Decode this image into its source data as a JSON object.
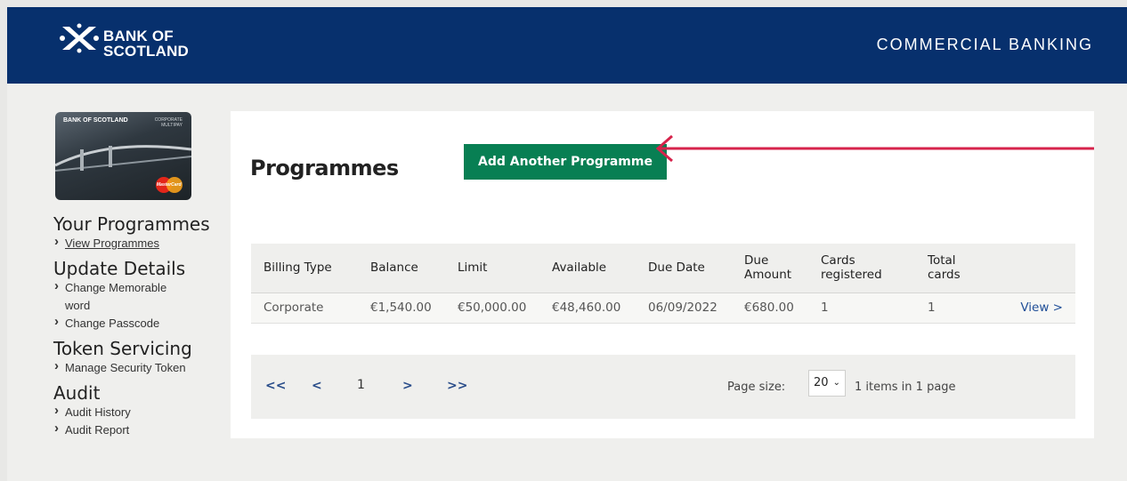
{
  "header": {
    "logo_line1": "BANK OF",
    "logo_line2": "SCOTLAND",
    "section": "COMMERCIAL BANKING"
  },
  "card": {
    "brand": "BANK OF SCOTLAND",
    "corp_line1": "CORPORATE",
    "corp_line2": "MULTIPAY",
    "network": "MasterCard"
  },
  "sidebar": {
    "sections": [
      {
        "title": "Your Programmes",
        "links": [
          "View Programmes"
        ]
      },
      {
        "title": "Update Details",
        "links": [
          "Change Memorable word",
          "Change Passcode"
        ]
      },
      {
        "title": "Token Servicing",
        "links": [
          "Manage Security Token"
        ]
      },
      {
        "title": "Audit",
        "links": [
          "Audit History",
          "Audit Report"
        ]
      }
    ]
  },
  "main": {
    "title": "Programmes",
    "add_button": "Add Another Programme",
    "table": {
      "headers": [
        "Billing Type",
        "Balance",
        "Limit",
        "Available",
        "Due Date",
        "Due Amount",
        "Cards registered",
        "Total cards",
        ""
      ],
      "rows": [
        [
          "Corporate",
          "€1,540.00",
          "€50,000.00",
          "€48,460.00",
          "06/09/2022",
          "€680.00",
          "1",
          "1",
          "View >"
        ]
      ]
    },
    "pager": {
      "first": "<<",
      "prev": "<",
      "page": "1",
      "next": ">",
      "last": ">>",
      "page_size_label": "Page size:",
      "page_size": "20",
      "items_info": "1 items in 1 page"
    }
  },
  "colors": {
    "header_bg": "#07306d",
    "button_bg": "#087f53",
    "arrow": "#d6234b",
    "link": "#1f4e97"
  }
}
